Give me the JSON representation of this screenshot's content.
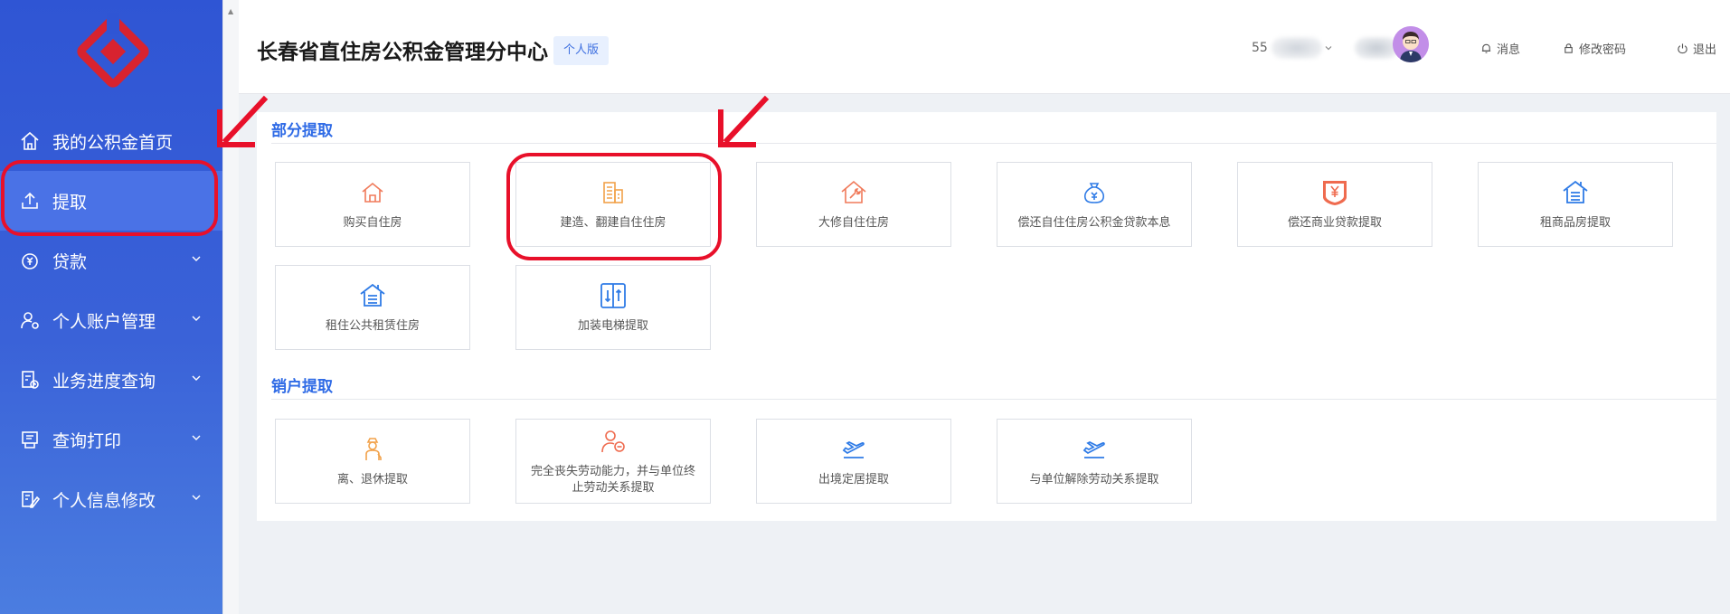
{
  "sidebar": {
    "items": [
      {
        "label": "我的公积金首页",
        "icon": "home-icon",
        "has_chevron": false
      },
      {
        "label": "提取",
        "icon": "upload-icon",
        "has_chevron": false,
        "active": true
      },
      {
        "label": "贷款",
        "icon": "money-bag-icon",
        "has_chevron": true
      },
      {
        "label": "个人账户管理",
        "icon": "user-settings-icon",
        "has_chevron": true
      },
      {
        "label": "业务进度查询",
        "icon": "progress-calendar-icon",
        "has_chevron": true
      },
      {
        "label": "查询打印",
        "icon": "printer-icon",
        "has_chevron": true
      },
      {
        "label": "个人信息修改",
        "icon": "edit-profile-icon",
        "has_chevron": true
      }
    ]
  },
  "header": {
    "title": "长春省直住房公积金管理分中心",
    "edition": "个人版",
    "user_prefix": "55",
    "messages_label": "消息",
    "change_password_label": "修改密码",
    "logout_label": "退出"
  },
  "sections": {
    "partial": {
      "title": "部分提取",
      "tiles": [
        {
          "label": "购买自住房",
          "icon": "house-icon",
          "color": "#f07a5a"
        },
        {
          "label": "建造、翻建自住住房",
          "icon": "building-icon",
          "color": "#f2a24a"
        },
        {
          "label": "大修自住住房",
          "icon": "house-repair-icon",
          "color": "#f07a5a"
        },
        {
          "label": "偿还自住住房公积金贷款本息",
          "icon": "money-bag-icon",
          "color": "#2f7be6"
        },
        {
          "label": "偿还商业贷款提取",
          "icon": "yen-badge-icon",
          "color": "#ef6b4f"
        },
        {
          "label": "租商品房提取",
          "icon": "rental-house-icon",
          "color": "#2f7be6"
        },
        {
          "label": "租住公共租赁住房",
          "icon": "rental-house-icon",
          "color": "#2f7be6"
        },
        {
          "label": "加装电梯提取",
          "icon": "elevator-icon",
          "color": "#2f7be6"
        }
      ]
    },
    "closure": {
      "title": "销户提取",
      "tiles": [
        {
          "label": "离、退休提取",
          "icon": "retiree-icon",
          "color": "#f2a24a"
        },
        {
          "label": "完全丧失劳动能力，并与单位终止劳动关系提取",
          "icon": "user-minus-icon",
          "color": "#ef6b4f"
        },
        {
          "label": "出境定居提取",
          "icon": "departure-plane-icon",
          "color": "#2f7be6"
        },
        {
          "label": "与单位解除劳动关系提取",
          "icon": "departure-plane-icon",
          "color": "#2f7be6"
        }
      ]
    }
  },
  "colors": {
    "sidebar_bg": "#3a62d8",
    "accent": "#2f6be6",
    "annotation": "#e8102a"
  }
}
